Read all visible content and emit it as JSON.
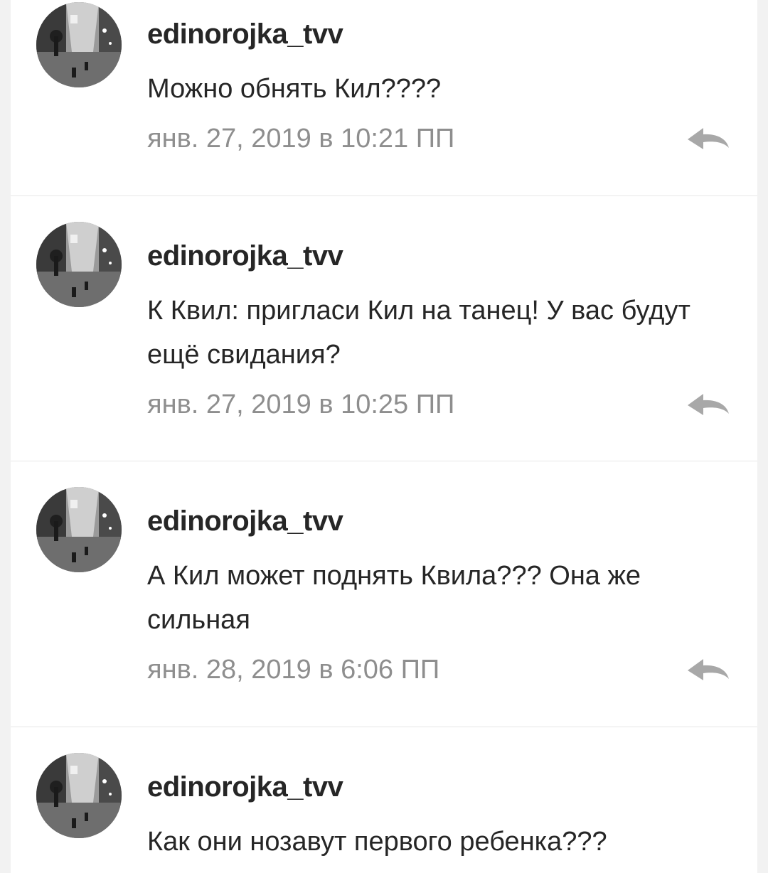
{
  "comments": [
    {
      "username": "edinorojka_tvv",
      "text": "Можно обнять Кил????",
      "time": "янв. 27, 2019 в 10:21 ПП"
    },
    {
      "username": "edinorojka_tvv",
      "text": "К Квил: пригласи Кил на танец! У вас будут ещё свидания?",
      "time": "янв. 27, 2019 в 10:25 ПП"
    },
    {
      "username": "edinorojka_tvv",
      "text": "А Кил может поднять Квила??? Она же сильная",
      "time": "янв. 28, 2019 в 6:06 ПП"
    },
    {
      "username": "edinorojka_tvv",
      "text": "Как они нозавут первого ребенка???"
    }
  ],
  "icons": {
    "avatar": "avatar-photo",
    "reply": "reply-arrow-icon"
  },
  "colors": {
    "username": "#262626",
    "text": "#262626",
    "timestamp": "#8e8e8e",
    "reply_icon": "#a8a8a8",
    "divider": "#e6e6e6"
  }
}
